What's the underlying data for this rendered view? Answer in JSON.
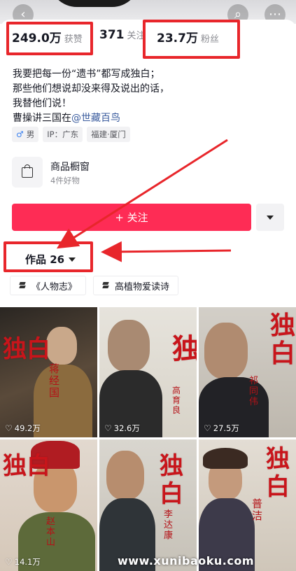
{
  "header": {
    "back_glyph": "‹",
    "search_glyph": "⌕",
    "more_glyph": "⋯"
  },
  "stats": {
    "likes_value": "249.0万",
    "likes_label": "获赞",
    "following_value": "371",
    "following_label": "关注",
    "fans_value": "23.7万",
    "fans_label": "粉丝"
  },
  "bio": {
    "line1": "我要把每一份“遗书”都写成独白；",
    "line2": "那些他们想说却没来得及说出的话，",
    "line3": "我替他们说！",
    "line4_prefix": "曹操讲三国在",
    "line4_mention": "@世藏百鸟"
  },
  "tags": {
    "gender_symbol": "♂",
    "gender": "男",
    "ip": "IP：广东",
    "location": "福建·厦门"
  },
  "shop": {
    "title": "商品橱窗",
    "subtitle": "4件好物"
  },
  "actions": {
    "follow_label": "+ 关注"
  },
  "works": {
    "tab_label": "作品 26"
  },
  "collections": [
    {
      "label": "《人物志》"
    },
    {
      "label": "高植物爱读诗"
    }
  ],
  "videos": [
    {
      "plays": "49.2万",
      "title": "独白",
      "name": "蒋经国"
    },
    {
      "plays": "32.6万",
      "title": "独",
      "name": "高育良"
    },
    {
      "plays": "27.5万",
      "title": "独白",
      "name": "祁同伟"
    },
    {
      "plays": "14.1万",
      "title": "独白",
      "name": "赵本山"
    },
    {
      "plays": "",
      "title": "独白",
      "name": "李达康"
    },
    {
      "plays": "",
      "title": "独白",
      "name": "普洁"
    }
  ],
  "watermark": "www.xunibaoku.com",
  "colors": {
    "follow_button": "#fe2c55",
    "highlight": "#e8262b",
    "mention": "#3b5c9e"
  }
}
